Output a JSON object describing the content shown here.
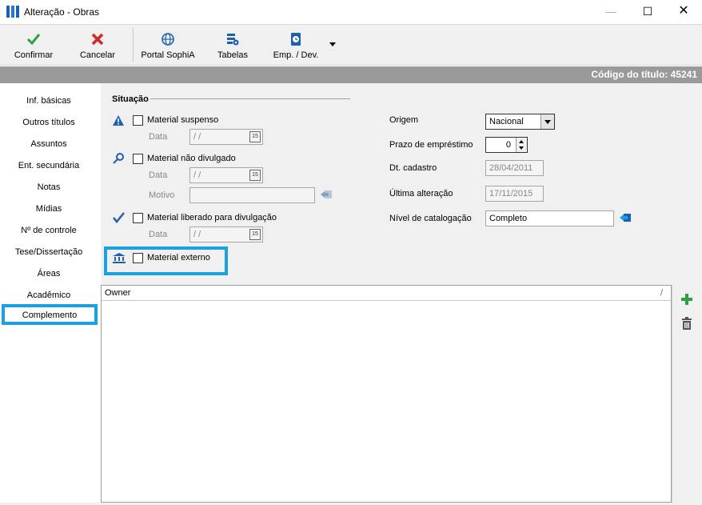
{
  "window": {
    "title": "Alteração - Obras",
    "minimize": "—",
    "maximize": "☐",
    "close": "✕"
  },
  "toolbar": {
    "confirmar": "Confirmar",
    "cancelar": "Cancelar",
    "portal": "Portal SophiA",
    "tabelas": "Tabelas",
    "emp_dev": "Emp. / Dev."
  },
  "codebar": {
    "code_text": "Código do título: 45241"
  },
  "nav": {
    "items": [
      {
        "label": "Inf. básicas"
      },
      {
        "label": "Outros títulos"
      },
      {
        "label": "Assuntos"
      },
      {
        "label": "Ent. secundária"
      },
      {
        "label": "Notas"
      },
      {
        "label": "Mídias"
      },
      {
        "label": "Nº de controle"
      },
      {
        "label": "Tese/Dissertação"
      },
      {
        "label": "Áreas"
      },
      {
        "label": "Acadêmico"
      },
      {
        "label": "Complemento"
      }
    ],
    "active": "Complemento"
  },
  "situacao": {
    "title": "Situação",
    "suspenso_label": "Material suspenso",
    "data_label": "Data",
    "data_value": " / /",
    "nao_divulgado_label": "Material não divulgado",
    "motivo_label": "Motivo",
    "motivo_value": "",
    "liberado_label": "Material liberado para divulgação",
    "externo_label": "Material externo"
  },
  "right": {
    "origem_label": "Origem",
    "origem_value": "Nacional",
    "prazo_label": "Prazo de empréstimo",
    "prazo_value": "0",
    "dt_cadastro_label": "Dt. cadastro",
    "dt_cadastro_value": "28/04/2011",
    "ultima_label": "Última alteração",
    "ultima_value": "17/11/2015",
    "nivel_label": "Nível de catalogação",
    "nivel_value": "Completo"
  },
  "grid": {
    "column_owner": "Owner",
    "sorter": "/"
  },
  "colors": {
    "accent": "#1ba1e2",
    "header_gray": "#9a9a9a",
    "confirm_green": "#2ea043",
    "cancel_red": "#d9232a"
  }
}
